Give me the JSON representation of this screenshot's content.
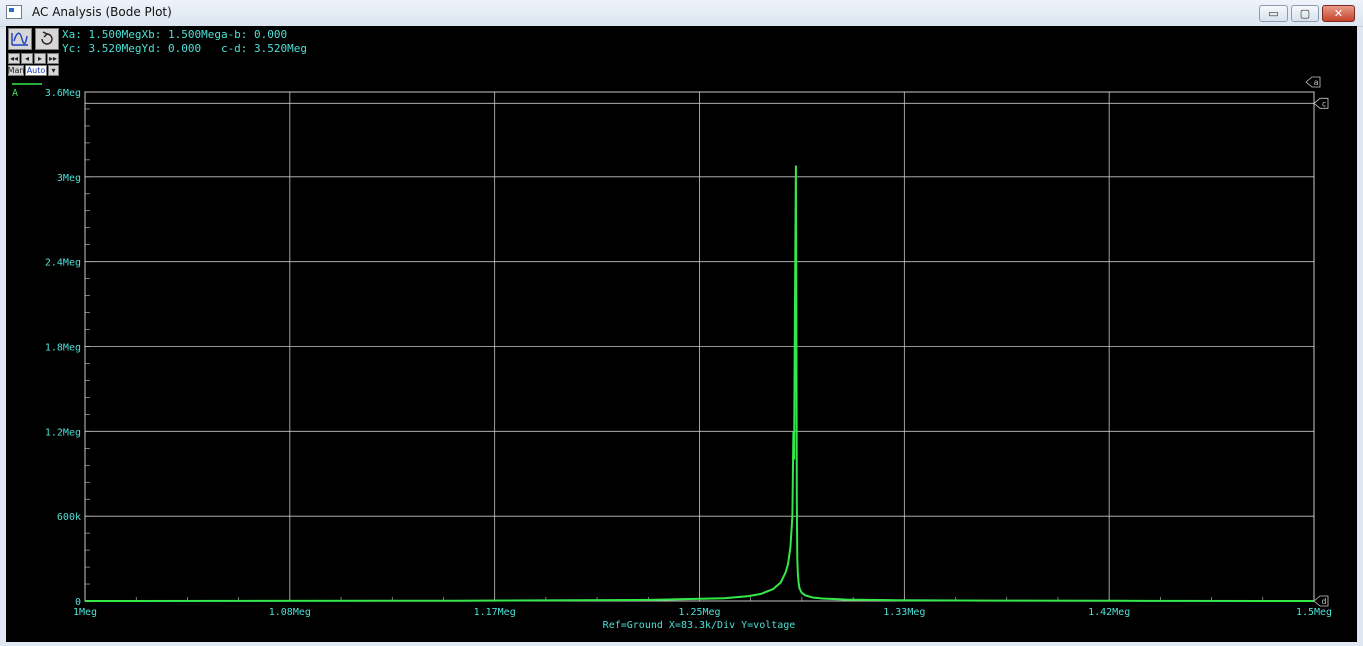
{
  "window": {
    "title": "AC Analysis (Bode Plot)",
    "controls": {
      "minimize": "▭",
      "maximize": "▢",
      "close": "✕"
    }
  },
  "toolbar": {
    "manual_label": "Man",
    "auto_label": "Auto"
  },
  "cursors": {
    "line1": "Xa: 1.500MegXb: 1.500Mega-b: 0.000",
    "line2": "Yc: 3.520MegYd: 0.000   c-d: 3.520Meg",
    "markers": [
      "a",
      "c",
      "d"
    ]
  },
  "trace_label": "A",
  "footer": "Ref=Ground  X=83.3k/Div Y=voltage",
  "colors": {
    "background": "#000000",
    "grid": "#c8c8c8",
    "text": "#4ce0d6",
    "trace": "#35e84a"
  },
  "chart_data": {
    "type": "line",
    "x_ticks": [
      "1Meg",
      "1.08Meg",
      "1.17Meg",
      "1.25Meg",
      "1.33Meg",
      "1.42Meg",
      "1.5Meg"
    ],
    "y_ticks": [
      "0",
      "600k",
      "1.2Meg",
      "1.8Meg",
      "2.4Meg",
      "3Meg",
      "3.6Meg"
    ],
    "xlim": [
      1000000,
      1500000
    ],
    "ylim": [
      0,
      3600000
    ],
    "grid": true,
    "series": [
      {
        "x": [
          1000000,
          1150000,
          1230000,
          1260000,
          1270000,
          1275000,
          1280000,
          1283000,
          1285000,
          1286000,
          1287000,
          1287800,
          1288200,
          1288500,
          1288800,
          1289200,
          1289400,
          1289600,
          1289800,
          1290000,
          1290300,
          1290700,
          1291500,
          1293000,
          1296000,
          1300000,
          1310000,
          1330000,
          1370000,
          1420000,
          1500000
        ],
        "y": [
          0,
          2000,
          8000,
          20000,
          35000,
          50000,
          85000,
          130000,
          200000,
          260000,
          380000,
          600000,
          1200000,
          1000000,
          2000000,
          3080000,
          2200000,
          700000,
          300000,
          200000,
          130000,
          90000,
          60000,
          40000,
          25000,
          18000,
          10000,
          6000,
          3000,
          1500,
          0
        ]
      }
    ]
  }
}
